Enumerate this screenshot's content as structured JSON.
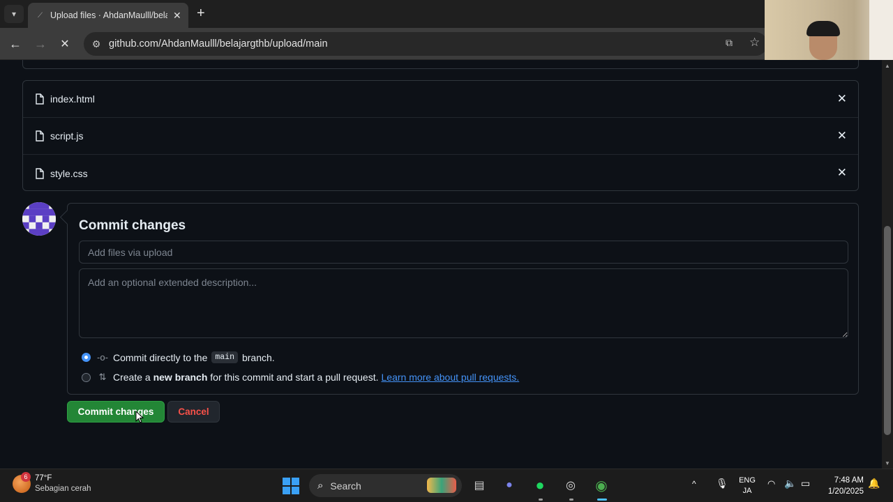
{
  "browser": {
    "tab_title": "Upload files · AhdanMaulll/belajargthb",
    "url": "github.com/AhdanMaulll/belajargthb/upload/main"
  },
  "files": [
    {
      "name": "index.html"
    },
    {
      "name": "script.js"
    },
    {
      "name": "style.css"
    }
  ],
  "commit": {
    "title": "Commit changes",
    "summary_placeholder": "Add files via upload",
    "description_placeholder": "Add an optional extended description...",
    "option_direct_prefix": "Commit directly to the",
    "branch_name": "main",
    "option_direct_suffix": "branch.",
    "option_new_prefix": "Create a",
    "option_new_bold": "new branch",
    "option_new_suffix": "for this commit and start a pull request.",
    "learn_more_link": "Learn more about pull requests.",
    "selected_option": "direct",
    "commit_button": "Commit changes",
    "cancel_button": "Cancel"
  },
  "taskbar": {
    "weather_temp": "77°F",
    "weather_desc": "Sebagian cerah",
    "weather_badge": "6",
    "search_label": "Search",
    "lang_line1": "ENG",
    "lang_line2": "JA",
    "time": "7:48 AM",
    "date": "1/20/2025"
  },
  "colors": {
    "page_bg": "#0d1117",
    "primary_button": "#238636",
    "danger_text": "#f85149",
    "link": "#4493f8"
  }
}
